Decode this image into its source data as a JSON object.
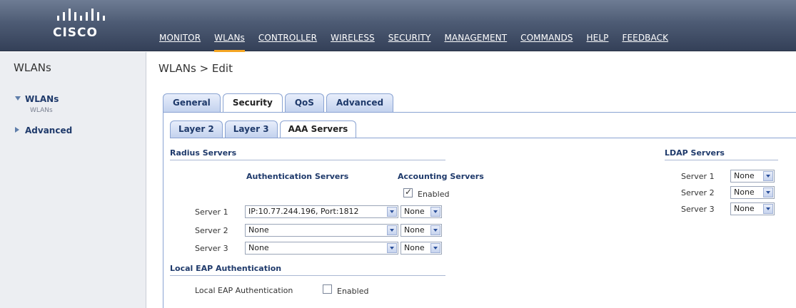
{
  "brand": {
    "logo_text": "CISCO"
  },
  "topnav": [
    "MONITOR",
    "WLANs",
    "CONTROLLER",
    "WIRELESS",
    "SECURITY",
    "MANAGEMENT",
    "COMMANDS",
    "HELP",
    "FEEDBACK"
  ],
  "topnav_active": "WLANs",
  "leftnav": {
    "title": "WLANs",
    "wlans": "WLANs",
    "wlans_sub": "WLANs",
    "advanced": "Advanced"
  },
  "page": {
    "title": "WLANs > Edit"
  },
  "tabs": [
    "General",
    "Security",
    "QoS",
    "Advanced"
  ],
  "active_tab": "Security",
  "subtabs": [
    "Layer 2",
    "Layer 3",
    "AAA Servers"
  ],
  "active_subtab": "AAA Servers",
  "radius": {
    "section": "Radius Servers",
    "auth_head": "Authentication Servers",
    "acct_head": "Accounting Servers",
    "acct_enabled_label": "Enabled",
    "acct_enabled": true,
    "servers": [
      {
        "label": "Server 1",
        "auth": "IP:10.77.244.196, Port:1812",
        "acct": "None"
      },
      {
        "label": "Server 2",
        "auth": "None",
        "acct": "None"
      },
      {
        "label": "Server 3",
        "auth": "None",
        "acct": "None"
      }
    ]
  },
  "local_eap": {
    "section": "Local EAP Authentication",
    "label": "Local EAP Authentication",
    "enabled_label": "Enabled",
    "enabled": false
  },
  "ldap": {
    "section": "LDAP Servers",
    "servers": [
      {
        "label": "Server 1",
        "value": "None"
      },
      {
        "label": "Server 2",
        "value": "None"
      },
      {
        "label": "Server 3",
        "value": "None"
      }
    ]
  },
  "colors": {
    "header": "#4d5b74",
    "accent": "#f5a623",
    "link": "#1f3a6b"
  }
}
